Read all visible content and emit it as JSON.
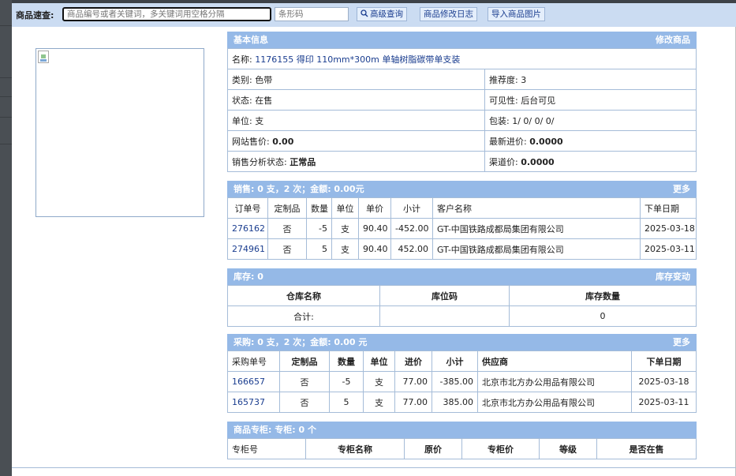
{
  "toolbar": {
    "label": "商品速查:",
    "search_placeholder": "商品编号或者关键词，多关键词用空格分隔",
    "barcode_placeholder": "条形码",
    "advanced_search": "高级查询",
    "modify_log": "商品修改日志",
    "import_images": "导入商品图片"
  },
  "basic": {
    "header": "基本信息",
    "edit_link": "修改商品",
    "name_label": "名称:",
    "name_value": "1176155 得印 110mm*300m 单轴树脂碳带单支装",
    "category": "类别: 色带",
    "recommend": "推荐度: 3",
    "status": "状态:  在售",
    "visibility": "可见性:  后台可见",
    "unit": "单位: 支",
    "packing": "包装:  1/ 0/ 0/ 0/",
    "web_price_label": "网站售价:",
    "web_price": "0.00",
    "latest_cost_label": "最新进价:",
    "latest_cost": "0.0000",
    "sales_status_label": "销售分析状态:",
    "sales_status": "正常品",
    "channel_price_label": "渠道价:",
    "channel_price": "0.0000"
  },
  "sales": {
    "header": "销售:  0 支，2 次；金额:  0.00元",
    "more": "更多",
    "columns": [
      "订单号",
      "定制品",
      "数量",
      "单位",
      "单价",
      "小计",
      "客户名称",
      "下单日期"
    ],
    "rows": [
      {
        "order": "276162",
        "custom": "否",
        "qty": "-5",
        "unit": "支",
        "price": "90.40",
        "subtotal": "-452.00",
        "customer": "GT-中国铁路成都局集团有限公司",
        "date": "2025-03-18"
      },
      {
        "order": "274961",
        "custom": "否",
        "qty": "5",
        "unit": "支",
        "price": "90.40",
        "subtotal": "452.00",
        "customer": "GT-中国铁路成都局集团有限公司",
        "date": "2025-03-11"
      }
    ]
  },
  "inventory": {
    "header": "库存:  0",
    "link": "库存变动",
    "columns": [
      "仓库名称",
      "库位码",
      "库存数量"
    ],
    "total_label": "合计:",
    "total_location": "",
    "total_qty": "0"
  },
  "purchase": {
    "header": "采购:  0 支，2 次；金额:  0.00 元",
    "more": "更多",
    "columns": [
      "采购单号",
      "定制品",
      "数量",
      "单位",
      "进价",
      "小计",
      "供应商",
      "下单日期"
    ],
    "rows": [
      {
        "order": "166657",
        "custom": "否",
        "qty": "-5",
        "unit": "支",
        "price": "77.00",
        "subtotal": "-385.00",
        "supplier": "北京市北方办公用品有限公司",
        "date": "2025-03-18"
      },
      {
        "order": "165737",
        "custom": "否",
        "qty": "5",
        "unit": "支",
        "price": "77.00",
        "subtotal": "385.00",
        "supplier": "北京市北方办公用品有限公司",
        "date": "2025-03-11"
      }
    ]
  },
  "counter": {
    "header": "商品专柜:  专柜:  0 个",
    "columns": [
      "专柜号",
      "专柜名称",
      "原价",
      "专柜价",
      "等级",
      "是否在售"
    ]
  }
}
